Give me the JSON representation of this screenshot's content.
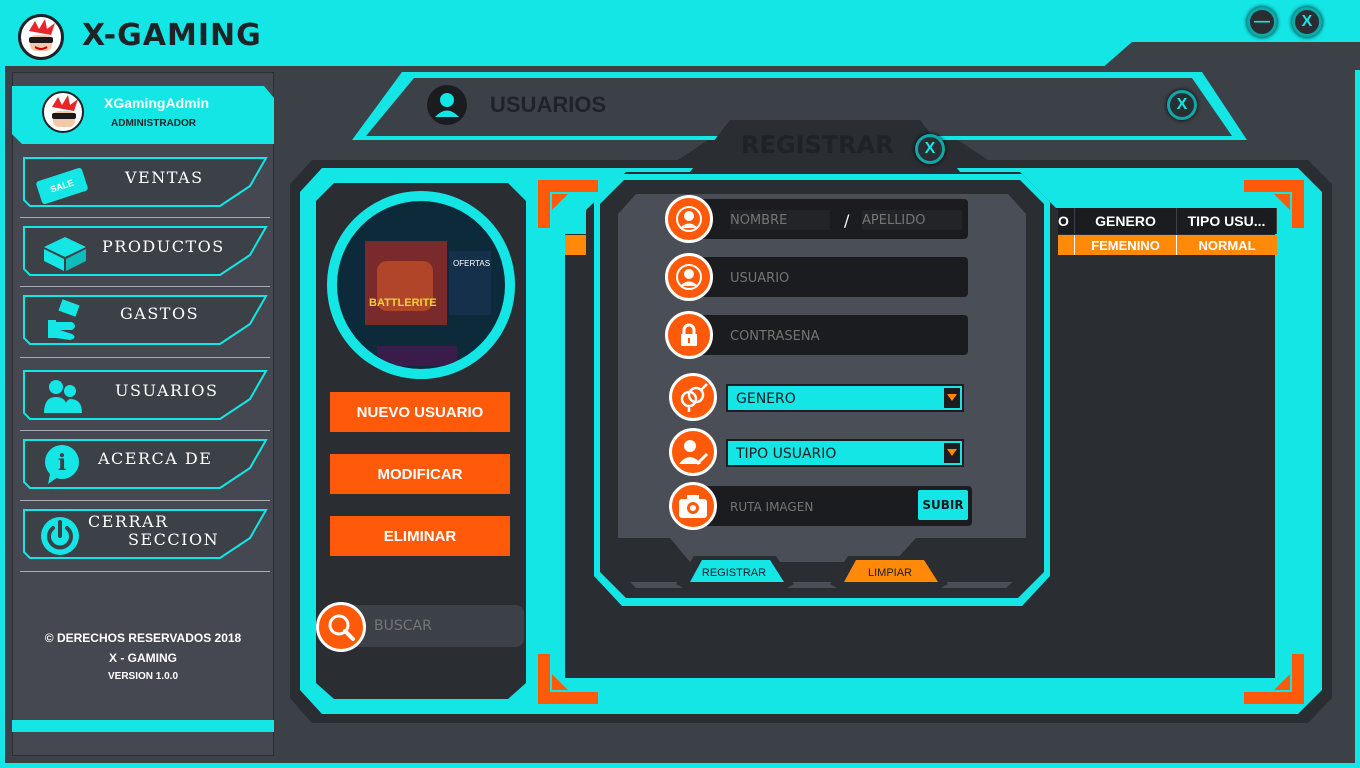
{
  "app": {
    "title": "X-GAMING"
  },
  "window_controls": {
    "minimize": "—",
    "close": "X"
  },
  "user": {
    "name": "XGamingAdmin",
    "role": "ADMINISTRADOR"
  },
  "nav": [
    {
      "label": "VENTAS",
      "icon": "sale-tag-icon"
    },
    {
      "label": "PRODUCTOS",
      "icon": "box-icon"
    },
    {
      "label": "GASTOS",
      "icon": "money-hand-icon"
    },
    {
      "label": "USUARIOS",
      "icon": "users-icon"
    },
    {
      "label": "ACERCA DE",
      "icon": "info-icon"
    },
    {
      "label_line1": "CERRAR",
      "label_line2": "SECCION",
      "icon": "power-icon"
    }
  ],
  "sale_badge": "SALE",
  "footer": {
    "copyright": "© DERECHOS RESERVADOS 2018",
    "brand": "X - GAMING",
    "version": "VERSION 1.0.0"
  },
  "panel": {
    "title": "USUARIOS",
    "close": "X"
  },
  "left_actions": {
    "new_user": "NUEVO USUARIO",
    "modify": "MODIFICAR",
    "delete": "ELIMINAR"
  },
  "search": {
    "placeholder": "BUSCAR"
  },
  "preview": {
    "game_title": "BATTLERITE",
    "offers": "OFERTAS"
  },
  "table": {
    "headers": [
      "O",
      "GENERO",
      "TIPO USU..."
    ],
    "rows": [
      [
        "",
        "FEMENINO",
        "NORMAL"
      ]
    ]
  },
  "register": {
    "title": "REGISTRAR",
    "close": "X",
    "nombre_placeholder": "NOMBRE",
    "separator": "/",
    "apellido_placeholder": "APELLIDO",
    "usuario_placeholder": "USUARIO",
    "password_placeholder": "CONTRASEÑA",
    "genero_value": "GENERO",
    "tipo_value": "TIPO USUARIO",
    "ruta_placeholder": "RUTA IMAGEN",
    "subir_label": "SUBIR",
    "registrar_label": "REGISTRAR",
    "limpiar_label": "LIMPIAR"
  },
  "colors": {
    "accent": "#14e6e6",
    "orange": "#ff5a0a",
    "dark": "#2a2d31"
  }
}
